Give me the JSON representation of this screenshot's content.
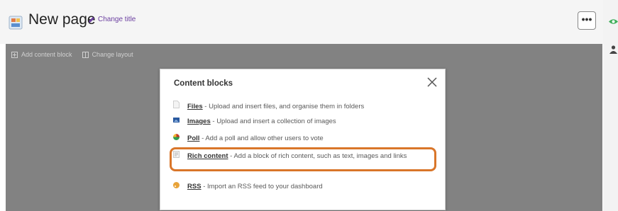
{
  "header": {
    "title": "New page",
    "change_title_label": "Change title",
    "more_label": "•••"
  },
  "toolbar": {
    "add_block_label": "Add content block",
    "change_layout_label": "Change layout"
  },
  "modal": {
    "title": "Content blocks",
    "close_glyph": "×",
    "items": [
      {
        "name": "Files",
        "desc": "- Upload and insert files, and organise them in folders",
        "icon": "file-icon",
        "color": "#e6e6e6"
      },
      {
        "name": "Images",
        "desc": "- Upload and insert a collection of images",
        "icon": "image-icon",
        "color": "#2a5aa0"
      },
      {
        "name": "Poll",
        "desc": "- Add a poll and allow other users to vote",
        "icon": "poll-icon",
        "color": "#c96a1e"
      },
      {
        "name": "Rich content",
        "desc": "- Add a block of rich content, such as text, images and links",
        "icon": "rich-content-icon",
        "color": "#c8c8c8"
      },
      {
        "name": "RSS",
        "desc": "- Import an RSS feed to your dashboard",
        "icon": "rss-icon",
        "color": "#e8a33a"
      }
    ]
  },
  "colors": {
    "accent_purple": "#6b3fa0",
    "highlight_orange": "#d9762a",
    "overlay_gray": "#828282"
  }
}
